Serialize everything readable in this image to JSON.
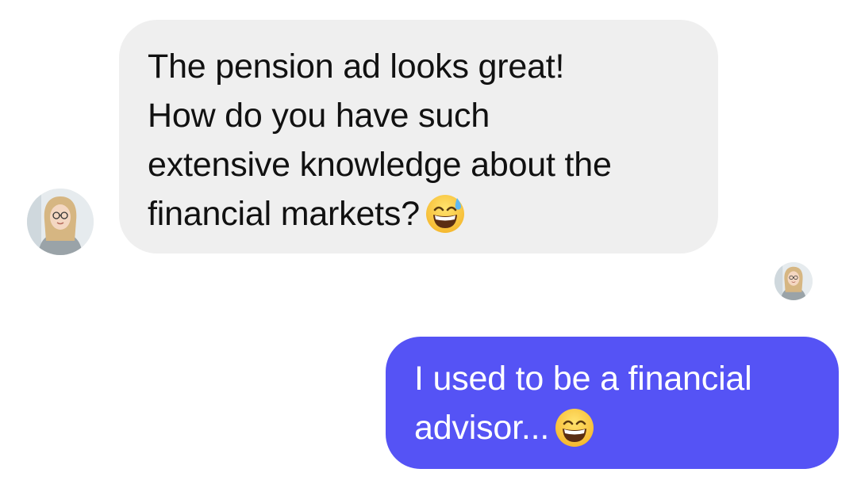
{
  "conversation": {
    "incoming": {
      "lines": [
        "The pension ad looks great!",
        "How do you have such",
        "extensive knowledge about the",
        "financial markets?"
      ],
      "emoji": "grinning-sweat-emoji",
      "avatar": "woman-with-glasses-avatar"
    },
    "outgoing": {
      "lines": [
        "I used to be a financial",
        "advisor..."
      ],
      "emoji": "grinning-smiling-eyes-emoji",
      "read_receipt_avatar": "woman-with-glasses-avatar"
    }
  },
  "colors": {
    "incoming_bubble": "#efefef",
    "outgoing_bubble": "#5553f5",
    "incoming_text": "#111111",
    "outgoing_text": "#ffffff"
  }
}
